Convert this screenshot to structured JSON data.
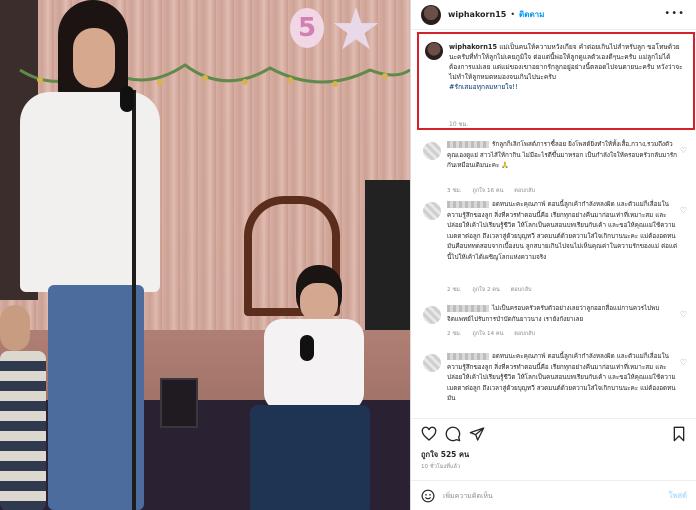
{
  "post": {
    "username": "wiphakorn15",
    "dot": "•",
    "follow_label": "ติดตาม",
    "more_label": "•••"
  },
  "caption": {
    "username": "wiphakorn15",
    "text": "แม่เป็นคนให้ความหวังเกียจ คำต่อยเกินไปสำหรับลูก ขอโทษด้วยนะครับที่ทำให้ลูกไม่เคยภูมิใจ ต่อแต่นี้พ่อให้ลูกดูแลตัวเองดีๆนะครับ แม่ลูกไม่ได้ต้องการแม่เลย แต่แม่ของเขาอยากรักลูกอยู่อย่างนี้ตลอดไปจนตายนะครับ หวังว่าจะไม่ทำให้ลูกหมดหมองจนเกินไปนะครับ",
    "hashtag": "#รักเสมอทุกลมหายใจ!!",
    "time": "10 ชม."
  },
  "comments": [
    {
      "text": "รักลูกก็เลิกโพสต์ภาราซี้ลอย ยิ่งโพสต์ยิ่งทำให้ทั้งเสื้อ,กวาง,รวมถึงตัวคุณเองดูแย่ สาวไส้ให้กากิน ไม่มีอะไรดีขึ้นมาหรอก เป็นกำลังใจให้ครอบครัวกลับมารักกันเหมือนเดิมนะคะ 🙏",
      "time": "3 ชม.",
      "likes": "ถูกใจ 16 คน",
      "reply": "ตอบกลับ"
    },
    {
      "text": "อดทนนะคะคุณภาพ์ ตอนนี้ลูกเค้ากำลังหลงผิด และตัวแม่ก็เลื่อมในความรู้สึกของลูก สิ่งที่ควรทำตอนนี้คือ เรียกทุกอย่างคืนมาก่อนเท่าที่เหมาะสม และปล่อยให้เค้าไปเรียนรู้ชีวิต ให้โลกเป็นคนสอนบทเรียนกับเค้า และขอให้คุณแม่ใช้ความเมตตาต่อลูก ถึงเวลาสู่ด้วยบุญทวี สวดมนต์ด้วยความใส่ใจเกิกบานนะคะ แม่ต้องอดทน มันคือบททดสอบจากเบื้องบน ลูกสบายเกินไปจนไม่เห็นคุณค่าในความรักของแม่ ต่อแต่นี้ไปให้เค้าได้เผชิญโลกแห่งความจริง",
      "time": "2 ชม.",
      "likes": "ถูกใจ 2 คน",
      "reply": "ตอบกลับ"
    },
    {
      "text": "ไม่เป็นครอบครัวครับตัวอย่างเลยว่าลูกออกสื่อแม่กานควรไปพบจิตแพทย์ไปรับการบำบัดกันยาวนาง เรายังกังยาเลย",
      "time": "2 ชม.",
      "likes": "ถูกใจ 14 คน",
      "reply": "ตอบกลับ"
    },
    {
      "text": "อดทนนะคะคุณภาพ์ ตอนนี้ลูกเค้ากำลังหลงผิด และตัวแม่ก็เลื่อมในความรู้สึกของลูก สิ่งที่ควรทำตอนนี้คือ เรียกทุกอย่างคืนมาก่อนเท่าที่เหมาะสม และปล่อยให้เค้าไปเรียนรู้ชีวิต ให้โลกเป็นคนสอนบทเรียนกับเค้า และขอให้คุณแม่ใช้ความเมตตาต่อลูก ถึงเวลาสู่ด้วยบุญทวี สวดมนต์ด้วยความใส่ใจเกิกบานนะคะ แม่ต้องอดทน มัน"
    }
  ],
  "actions": {
    "likes": "ถูกใจ 525 คน",
    "date": "10 ชั่วโมงที่แล้ว"
  },
  "add_comment": {
    "placeholder": "เพิ่มความคิดเห็น",
    "post_label": "โพสต์"
  },
  "icons": {
    "heart": "heart-icon",
    "comment": "comment-icon",
    "share": "share-icon",
    "save": "bookmark-icon",
    "emoji": "emoji-icon"
  },
  "colors": {
    "highlight_border": "#d4212b",
    "link_blue": "#0095f6",
    "hashtag": "#00376b",
    "muted": "#8e8e8e"
  }
}
